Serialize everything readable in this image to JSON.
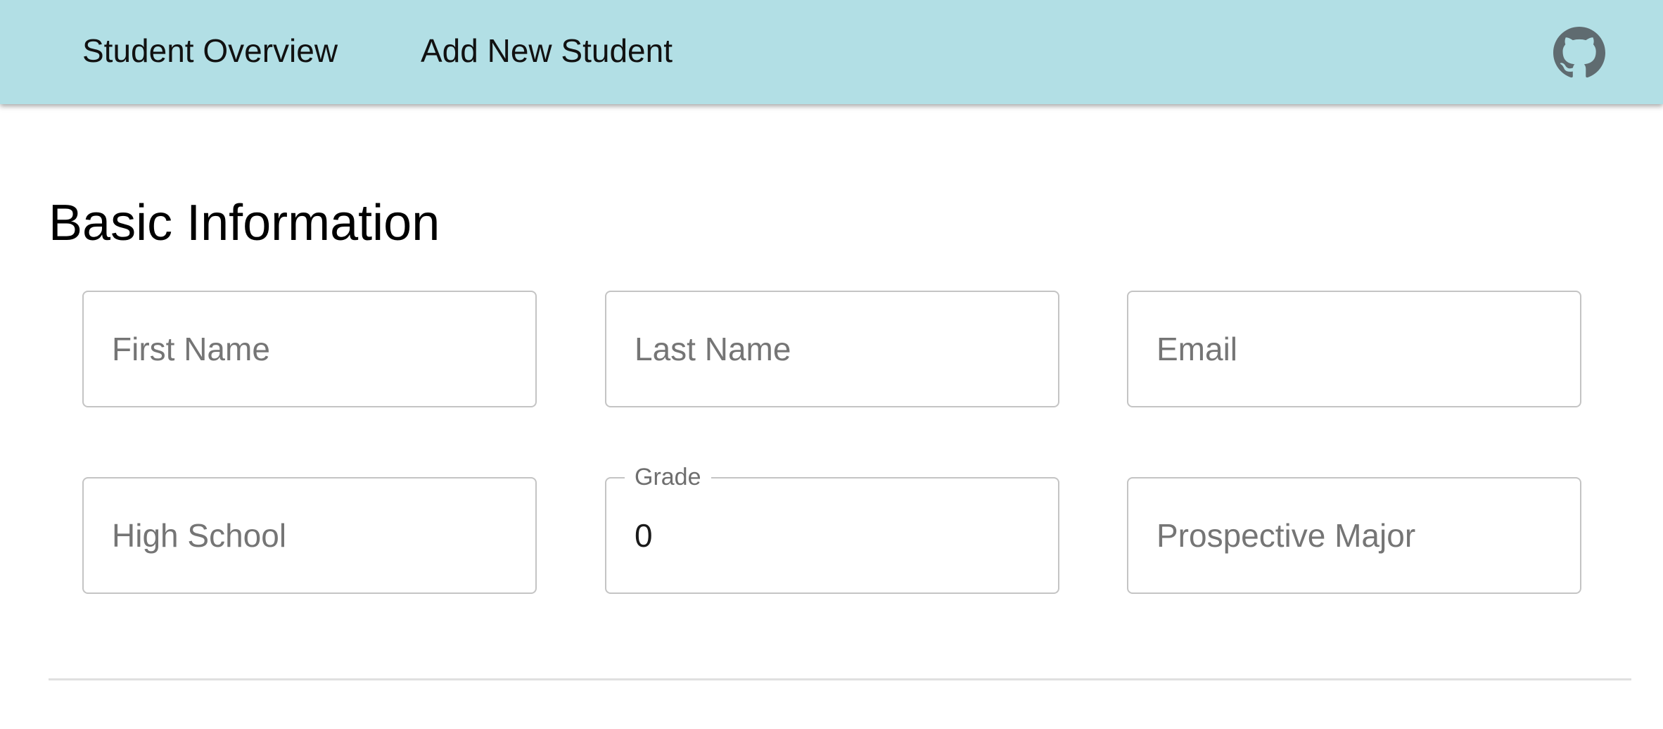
{
  "nav": {
    "links": [
      {
        "label": "Student Overview"
      },
      {
        "label": "Add New Student"
      }
    ],
    "github_icon": "github-icon",
    "background_color": "#b2dfe5"
  },
  "section": {
    "title": "Basic Information"
  },
  "form": {
    "first_name": {
      "placeholder": "First Name",
      "value": ""
    },
    "last_name": {
      "placeholder": "Last Name",
      "value": ""
    },
    "email": {
      "placeholder": "Email",
      "value": ""
    },
    "high_school": {
      "placeholder": "High School",
      "value": ""
    },
    "grade": {
      "label": "Grade",
      "value": "0"
    },
    "prospective_major": {
      "placeholder": "Prospective Major",
      "value": ""
    }
  }
}
